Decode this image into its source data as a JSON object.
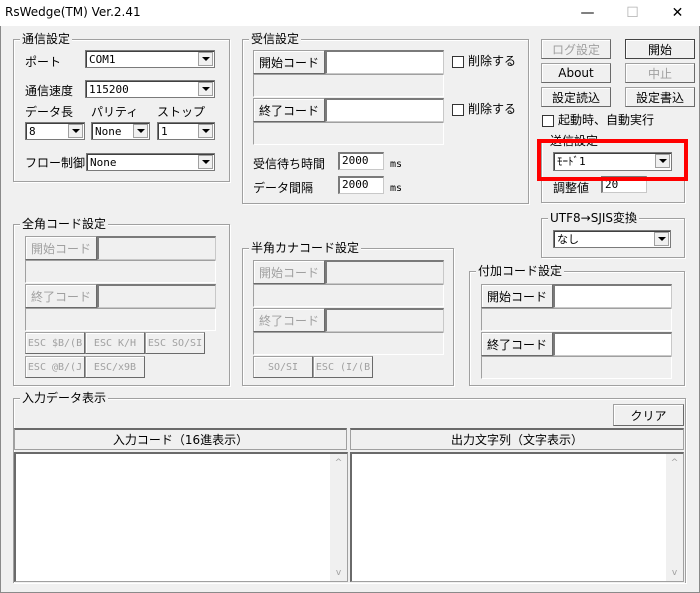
{
  "window": {
    "title": "RsWedge(TM) Ver.2.41",
    "controls": {
      "minimize": "—",
      "maximize": "☐",
      "close": "✕"
    }
  },
  "comm_settings": {
    "legend": "通信設定",
    "port_label": "ポート",
    "port_value": "COM1",
    "baud_label": "通信速度",
    "baud_value": "115200",
    "databits_label": "データ長",
    "databits_value": "8",
    "parity_label": "パリティ",
    "parity_value": "None",
    "stopbits_label": "ストップ",
    "stopbits_value": "1",
    "flow_label": "フロー制御",
    "flow_value": "None"
  },
  "receive_settings": {
    "legend": "受信設定",
    "start_code_button": "開始コード",
    "start_code_value": "",
    "start_delete_label": "削除する",
    "end_code_button": "終了コード",
    "end_code_value": "",
    "end_delete_label": "削除する",
    "wait_time_label": "受信待ち時間",
    "wait_time_value": "2000",
    "wait_time_unit": "ms",
    "interval_label": "データ間隔",
    "interval_value": "2000",
    "interval_unit": "ms"
  },
  "actions": {
    "log_settings": "ログ設定",
    "start": "開始",
    "about": "About",
    "stop": "中止",
    "load_settings": "設定読込",
    "save_settings": "設定書込",
    "autorun_label": "起動時、自動実行"
  },
  "send_settings": {
    "legend": "送信設定",
    "mode_value": "ﾓｰﾄﾞ1",
    "adjust_label": "調整値",
    "adjust_value": "20"
  },
  "utf8_conv": {
    "legend": "UTF8→SJIS変換",
    "value": "なし"
  },
  "fullwidth_settings": {
    "legend": "全角コード設定",
    "start_code_button": "開始コード",
    "end_code_button": "終了コード",
    "esc_buttons": [
      "ESC $B/(B",
      "ESC K/H",
      "ESC SO/SI",
      "ESC @B/(J",
      "ESC/x9B"
    ]
  },
  "halfkana_settings": {
    "legend": "半角カナコード設定",
    "start_code_button": "開始コード",
    "end_code_button": "終了コード",
    "buttons": [
      "SO/SI",
      "ESC (I/(B"
    ]
  },
  "append_settings": {
    "legend": "付加コード設定",
    "start_code_button": "開始コード",
    "start_code_value": "",
    "end_code_button": "終了コード",
    "end_code_value": ""
  },
  "input_display": {
    "legend": "入力データ表示",
    "clear_button": "クリア",
    "hex_header": "入力コード（16進表示）",
    "text_header": "出力文字列（文字表示）",
    "scroll_up": "^",
    "scroll_down": "v"
  },
  "highlight_color": "#ff0000"
}
